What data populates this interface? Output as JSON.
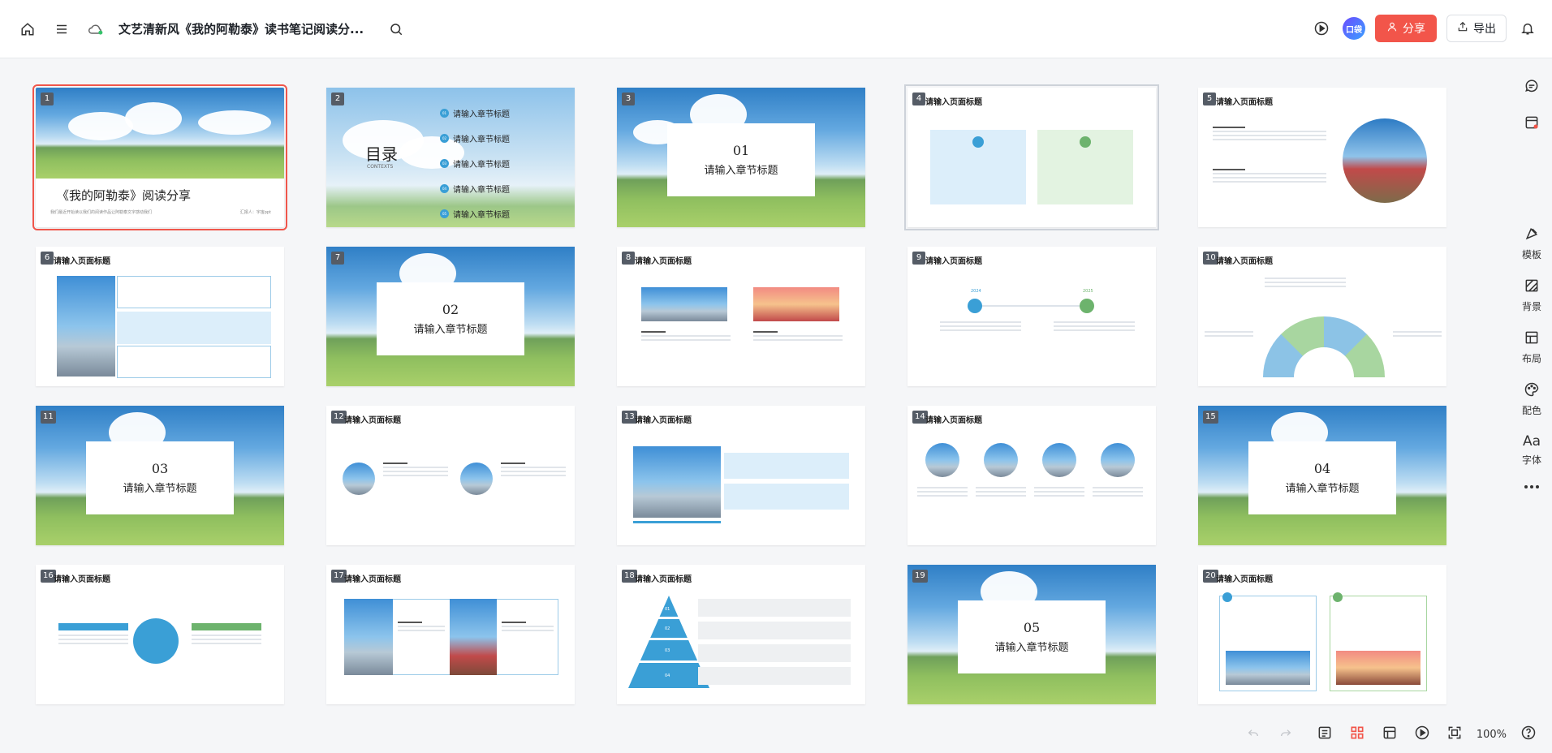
{
  "header": {
    "title": "文艺清新风《我的阿勒泰》读书笔记阅读分...",
    "avatar_text": "口袋",
    "share_label": "分享",
    "export_label": "导出"
  },
  "slides": [
    {
      "num": "1",
      "title": "《我的阿勒泰》阅读分享",
      "subtitle": "我们最近开始读以我们的阅读作品让阿勒泰文字感动我们",
      "footer": "汇报人：宇宙ppt"
    },
    {
      "num": "2",
      "title": "目录",
      "subtitle": "CONTEXTS",
      "items": [
        "请输入章节标题",
        "请输入章节标题",
        "请输入章节标题",
        "请输入章节标题",
        "请输入章节标题"
      ],
      "item_nums": [
        "01",
        "02",
        "03",
        "04",
        "05"
      ]
    },
    {
      "num": "3",
      "chapter": "01",
      "label": "请输入章节标题"
    },
    {
      "num": "4",
      "title": "请输入页面标题"
    },
    {
      "num": "5",
      "title": "请输入页面标题"
    },
    {
      "num": "6",
      "title": "请输入页面标题"
    },
    {
      "num": "7",
      "chapter": "02",
      "label": "请输入章节标题"
    },
    {
      "num": "8",
      "title": "请输入页面标题"
    },
    {
      "num": "9",
      "title": "请输入页面标题",
      "years": [
        "2024",
        "2025"
      ]
    },
    {
      "num": "10",
      "title": "请输入页面标题"
    },
    {
      "num": "11",
      "chapter": "03",
      "label": "请输入章节标题"
    },
    {
      "num": "12",
      "title": "请输入页面标题"
    },
    {
      "num": "13",
      "title": "请输入页面标题"
    },
    {
      "num": "14",
      "title": "请输入页面标题"
    },
    {
      "num": "15",
      "chapter": "04",
      "label": "请输入章节标题"
    },
    {
      "num": "16",
      "title": "请输入页面标题"
    },
    {
      "num": "17",
      "title": "请输入页面标题"
    },
    {
      "num": "18",
      "title": "请输入页面标题",
      "levels": [
        "01",
        "02",
        "03",
        "04"
      ]
    },
    {
      "num": "19",
      "chapter": "05",
      "label": "请输入章节标题"
    },
    {
      "num": "20",
      "title": "请输入页面标题"
    }
  ],
  "sidebar": {
    "items": [
      {
        "label": "模板",
        "icon": "template-icon"
      },
      {
        "label": "背景",
        "icon": "background-icon"
      },
      {
        "label": "布局",
        "icon": "layout-icon"
      },
      {
        "label": "配色",
        "icon": "palette-icon"
      },
      {
        "label": "字体",
        "icon": "font-icon",
        "glyph": "Aa"
      }
    ]
  },
  "footer": {
    "zoom": "100%"
  },
  "colors": {
    "accent": "#f2554a",
    "brand_blue": "#3a9fd6",
    "brand_green": "#6db36d"
  }
}
